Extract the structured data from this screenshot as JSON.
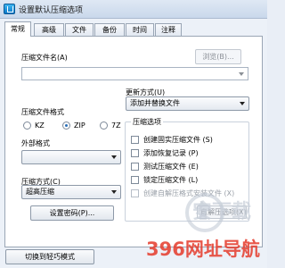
{
  "window": {
    "title": "设置默认压缩选项"
  },
  "tabs": [
    {
      "label": "常规",
      "active": true
    },
    {
      "label": "高级",
      "active": false
    },
    {
      "label": "文件",
      "active": false
    },
    {
      "label": "备份",
      "active": false
    },
    {
      "label": "时间",
      "active": false
    },
    {
      "label": "注释",
      "active": false
    }
  ],
  "archive_name": {
    "label": "压缩文件名(A)",
    "value": "",
    "browse_label": "浏览(B)..."
  },
  "update_mode": {
    "label": "更新方式(U)",
    "value": "添加并替换文件"
  },
  "archive_format": {
    "label": "压缩文件格式",
    "options": [
      {
        "label": "KZ",
        "selected": false
      },
      {
        "label": "ZIP",
        "selected": true
      },
      {
        "label": "7Z",
        "selected": false
      }
    ]
  },
  "external_format": {
    "label": "外部格式",
    "value": ""
  },
  "compression_method": {
    "label": "压缩方式(C)",
    "value": "超高压缩"
  },
  "set_password": {
    "label": "设置密码(P)..."
  },
  "compression_options": {
    "title": "压缩选项",
    "items": [
      {
        "label": "创建固实压缩文件 (S)",
        "checked": false,
        "enabled": true
      },
      {
        "label": "添加恢复记录 (P)",
        "checked": false,
        "enabled": true
      },
      {
        "label": "测试压缩文件 (E)",
        "checked": false,
        "enabled": true
      },
      {
        "label": "锁定压缩文件 (L)",
        "checked": false,
        "enabled": true
      },
      {
        "label": "创建自解压格式安装文件 (X)",
        "checked": false,
        "enabled": false
      }
    ],
    "self_extract_options_label": "自解压选项(X)"
  },
  "bottom": {
    "switch_mode_label": "切换到轻巧模式"
  },
  "watermark": {
    "text": "安下载",
    "domain": "396网址导航"
  },
  "colors": {
    "accent": "#2b6fb8",
    "watermark_red": "#e53a2b"
  }
}
